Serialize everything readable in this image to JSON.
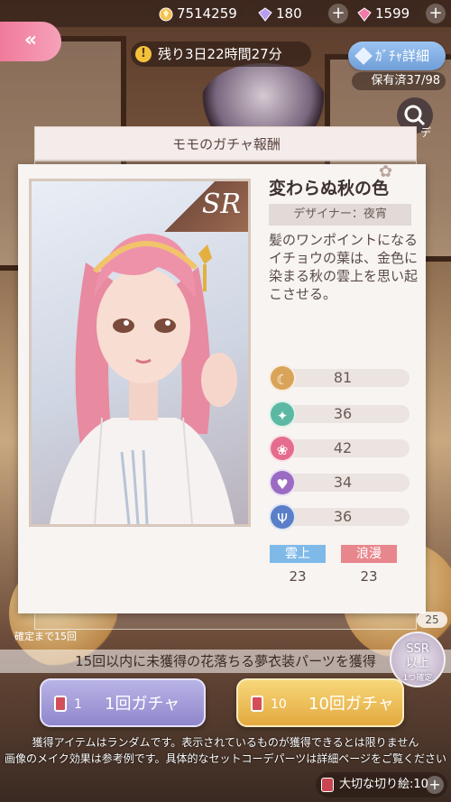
{
  "resources": [
    {
      "icon": "coin-icon",
      "value": "7514259"
    },
    {
      "icon": "diamond-icon",
      "value": "180"
    },
    {
      "icon": "pink-diamond-icon",
      "value": "1599"
    }
  ],
  "back_button": {
    "label": "«"
  },
  "timer": {
    "text": "残り3日22時間27分"
  },
  "gacha_detail_button": {
    "label": "ｶﾞﾁｬ詳細"
  },
  "owned_count": {
    "text": "保有済37/98"
  },
  "side_label": "デ",
  "panel": {
    "title": "モモのガチャ報酬",
    "rarity": "SR",
    "item_name": "変わらぬ秋の色",
    "designer": "デザイナー：夜宵",
    "description": "髪のワンポイントになるイチョウの葉は、金色に染まる秋の雲上を思い起こさせる。",
    "stats": [
      {
        "icon": "elegant-icon",
        "value": "81",
        "color": "#d9a45a"
      },
      {
        "icon": "fresh-icon",
        "value": "36",
        "color": "#5cb8a2"
      },
      {
        "icon": "sweet-icon",
        "value": "42",
        "color": "#e56c8c"
      },
      {
        "icon": "sexy-icon",
        "value": "34",
        "color": "#9b6bc4"
      },
      {
        "icon": "cool-icon",
        "value": "36",
        "color": "#5a7fc8"
      }
    ],
    "tags": [
      {
        "label": "雲上",
        "value": "23",
        "color": "#7fb9e8"
      },
      {
        "label": "浪漫",
        "value": "23",
        "color": "#e8868d"
      }
    ]
  },
  "confirm_note": "確定まで15回",
  "pity_counter": "25",
  "info_text": "15回以内に未獲得の花落ちる夢衣装パーツを獲得",
  "ssr_badge": {
    "line1": "SSR",
    "line2": "以上",
    "line3": "1つ確定"
  },
  "buttons": {
    "single": {
      "count": "1",
      "label": "1回ガチャ"
    },
    "ten": {
      "count": "10",
      "label": "10回ガチャ"
    }
  },
  "notices": [
    "獲得アイテムはランダムです。表示されているものが獲得できるとは限りません",
    "画像のメイク効果は参考例です。具体的なセットコーデパーツは詳細ページをご覧ください"
  ],
  "ticket": {
    "label": "大切な切り絵:10"
  }
}
